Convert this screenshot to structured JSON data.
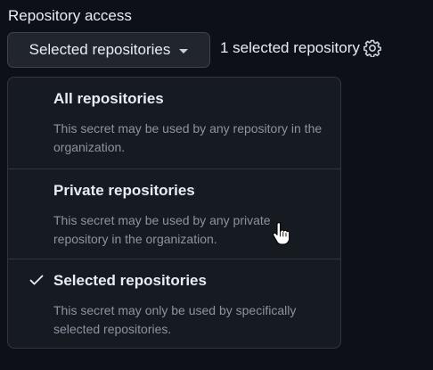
{
  "section": {
    "label": "Repository access"
  },
  "select": {
    "value": "Selected repositories"
  },
  "status": {
    "selected_count_text": "1 selected repository"
  },
  "menu": {
    "items": [
      {
        "title": "All repositories",
        "description": "This secret may be used by any repository in the organization.",
        "checked": false
      },
      {
        "title": "Private repositories",
        "description": "This secret may be used by any private repository in the organization.",
        "checked": false
      },
      {
        "title": "Selected repositories",
        "description": "This secret may only be used by specifically selected repositories.",
        "checked": true
      }
    ]
  },
  "icons": {
    "caret": "caret-down-icon",
    "gear": "gear-icon",
    "check": "check-icon",
    "cursor": "hand-pointer-cursor"
  },
  "colors": {
    "background": "#0d1117",
    "menu_bg": "#161b22",
    "button_bg": "#21262d",
    "border": "#30363d",
    "text": "#e6edf3",
    "muted": "#8b949e"
  }
}
